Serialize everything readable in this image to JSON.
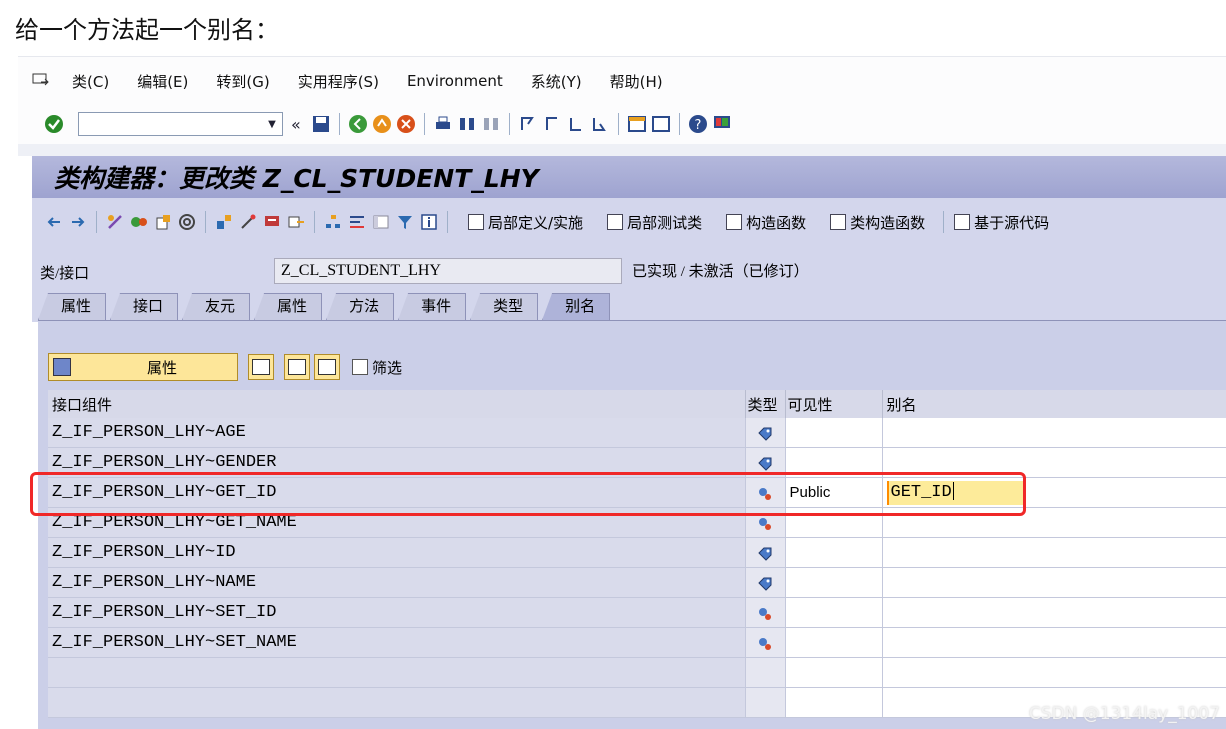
{
  "caption": "给一个方法起一个别名：",
  "menubar": {
    "items": [
      "类(C)",
      "编辑(E)",
      "转到(G)",
      "实用程序(S)",
      "Environment",
      "系统(Y)",
      "帮助(H)"
    ]
  },
  "toolbar": {
    "command_field_value": ""
  },
  "title": "类构建器：更改类 Z_CL_STUDENT_LHY",
  "app_toolbar": {
    "buttons": [
      "局部定义/实施",
      "局部测试类",
      "构造函数",
      "类构造函数",
      "基于源代码"
    ]
  },
  "header": {
    "label": "类/接口",
    "value": "Z_CL_STUDENT_LHY",
    "status": "已实现 / 未激活（已修订）"
  },
  "tabs": [
    "属性",
    "接口",
    "友元",
    "属性",
    "方法",
    "事件",
    "类型",
    "别名"
  ],
  "active_tab": "别名",
  "panel_toolbar": {
    "attr_button": "属性",
    "filter_label": "筛选",
    "filter_checked": false
  },
  "grid": {
    "columns": [
      "接口组件",
      "类型",
      "可见性",
      "别名"
    ],
    "rows": [
      {
        "component": "Z_IF_PERSON_LHY~AGE",
        "type": "attribute-icon",
        "visibility": "",
        "alias": ""
      },
      {
        "component": "Z_IF_PERSON_LHY~GENDER",
        "type": "attribute-icon",
        "visibility": "",
        "alias": ""
      },
      {
        "component": "Z_IF_PERSON_LHY~GET_ID",
        "type": "method-icon",
        "visibility": "Public",
        "alias": "GET_ID"
      },
      {
        "component": "Z_IF_PERSON_LHY~GET_NAME",
        "type": "method-icon",
        "visibility": "",
        "alias": ""
      },
      {
        "component": "Z_IF_PERSON_LHY~ID",
        "type": "attribute-icon",
        "visibility": "",
        "alias": ""
      },
      {
        "component": "Z_IF_PERSON_LHY~NAME",
        "type": "attribute-icon",
        "visibility": "",
        "alias": ""
      },
      {
        "component": "Z_IF_PERSON_LHY~SET_ID",
        "type": "method-icon",
        "visibility": "",
        "alias": ""
      },
      {
        "component": "Z_IF_PERSON_LHY~SET_NAME",
        "type": "method-icon",
        "visibility": "",
        "alias": ""
      },
      {
        "component": "",
        "type": "",
        "visibility": "",
        "alias": ""
      },
      {
        "component": "",
        "type": "",
        "visibility": "",
        "alias": ""
      }
    ]
  },
  "watermark": "CSDN @1314lay_1007",
  "colors": {
    "title_bg": "#a6abd4",
    "panel_bg": "#cbcfe8",
    "highlight": "#f02828",
    "active_cell": "#fdeb9a"
  }
}
